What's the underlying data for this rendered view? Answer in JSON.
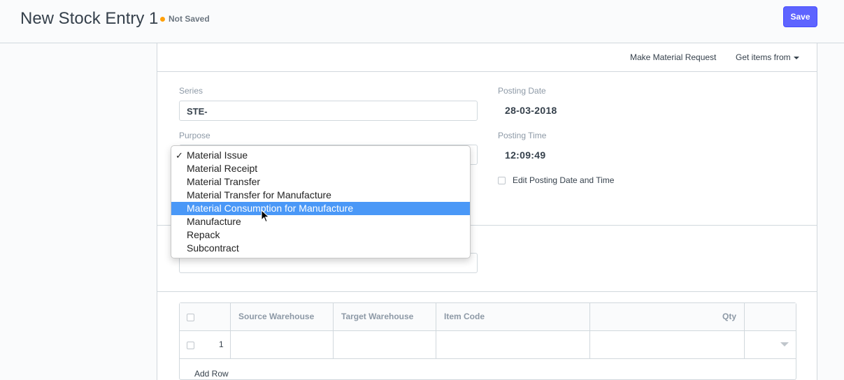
{
  "header": {
    "title": "New Stock Entry 1",
    "status": "Not Saved",
    "save_label": "Save",
    "status_color": "#ffa00a",
    "accent": "#5e64ff"
  },
  "toolbar": {
    "make_request": "Make Material Request",
    "get_items": "Get items from"
  },
  "form": {
    "series_label": "Series",
    "series_value": "STE-",
    "purpose_label": "Purpose",
    "posting_date_label": "Posting Date",
    "posting_date": "28-03-2018",
    "posting_time_label": "Posting Time",
    "posting_time": "12:09:49",
    "edit_posting_label": "Edit Posting Date and Time"
  },
  "purpose_dropdown": {
    "options": [
      "Material Issue",
      "Material Receipt",
      "Material Transfer",
      "Material Transfer for Manufacture",
      "Material Consumption for Manufacture",
      "Manufacture",
      "Repack",
      "Subcontract"
    ],
    "checked": "Material Issue",
    "highlighted": "Material Consumption for Manufacture",
    "highlight_color": "#4a98f7"
  },
  "items_table": {
    "columns": [
      "Source Warehouse",
      "Target Warehouse",
      "Item Code",
      "Qty"
    ],
    "rows": [
      {
        "index": "1",
        "source": "",
        "target": "",
        "item_code": "",
        "qty": ""
      }
    ],
    "add_row": "Add Row"
  }
}
